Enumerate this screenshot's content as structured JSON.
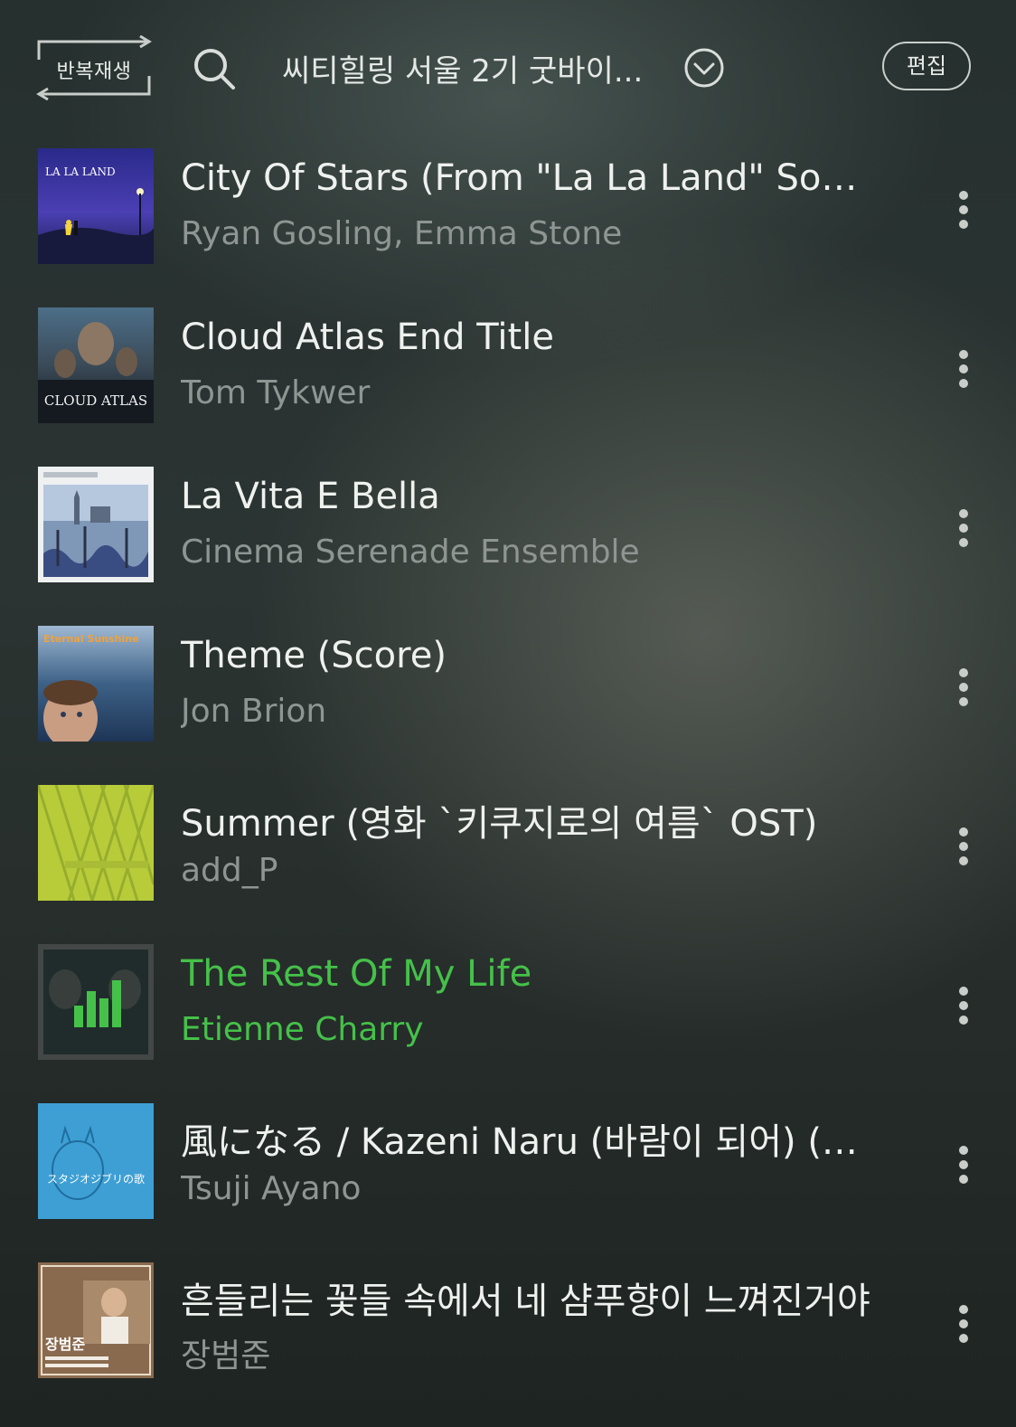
{
  "header": {
    "repeat_label": "반복재생",
    "playlist_title": "씨티힐링 서울 2기 굿바이...",
    "edit_label": "편집",
    "icons": [
      "repeat-icon",
      "search-icon",
      "chevron-down-icon"
    ]
  },
  "colors": {
    "accent_playing": "#45c14a",
    "artist_gray": "#8e9592"
  },
  "tracks": [
    {
      "title": "City Of Stars (From \"La La Land\" Soun...",
      "artist": "Ryan Gosling, Emma Stone",
      "cover_text": "LA LA LAND",
      "playing": false
    },
    {
      "title": "Cloud Atlas End Title",
      "artist": "Tom Tykwer",
      "cover_text": "CLOUD ATLAS",
      "playing": false
    },
    {
      "title": "La Vita E Bella",
      "artist": "Cinema Serenade Ensemble",
      "cover_text": "",
      "playing": false
    },
    {
      "title": "Theme (Score)",
      "artist": "Jon Brion",
      "cover_text": "Eternal Sunshine",
      "playing": false
    },
    {
      "title": "Summer (영화 `키쿠지로의 여름` OST)",
      "artist": "add_P",
      "cover_text": "",
      "playing": false
    },
    {
      "title": "The Rest Of My Life",
      "artist": "Etienne Charry",
      "cover_text": "",
      "playing": true
    },
    {
      "title": "風になる / Kazeni Naru (바람이 되어) (영...",
      "artist": "Tsuji Ayano",
      "cover_text": "スタジオジブリの歌",
      "playing": false
    },
    {
      "title": "흔들리는 꽃들 속에서 네 샴푸향이 느껴진거야",
      "artist": "장범준",
      "cover_text": "장범준",
      "playing": false
    }
  ]
}
